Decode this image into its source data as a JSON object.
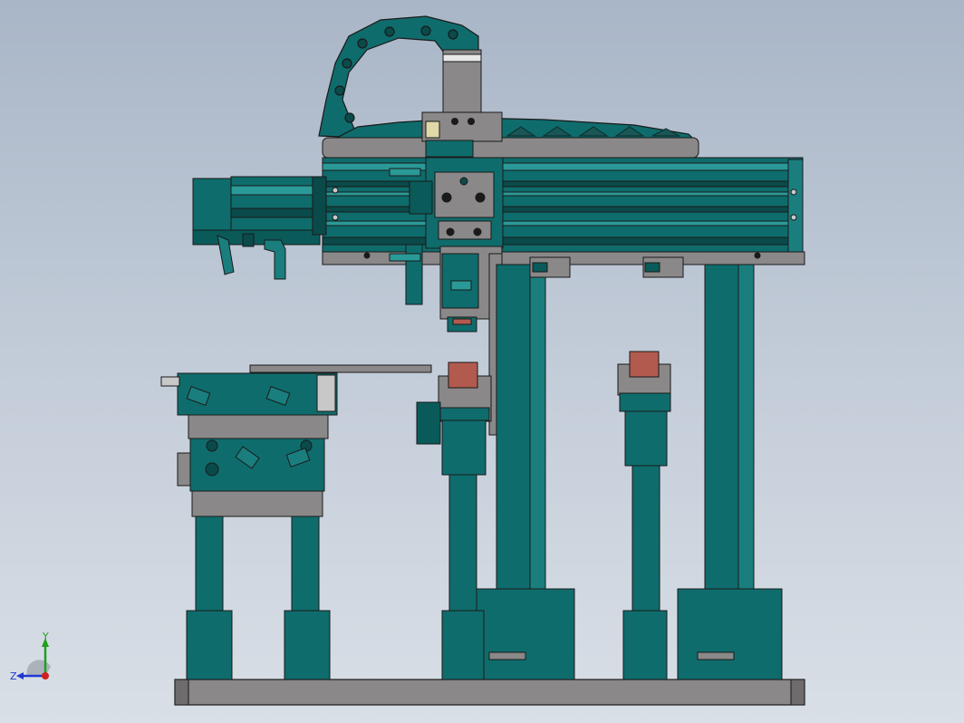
{
  "viewport": {
    "background_top": "#a9b6c7",
    "background_bottom": "#d9dfe6"
  },
  "palette": {
    "teal": "#0f6c6c",
    "teal_dark": "#0a4a4a",
    "teal_light": "#2a9a98",
    "steel": "#8a8888",
    "steel_dark": "#5e5c5c",
    "steel_light": "#b0aeae",
    "red_pad": "#b35a4e",
    "outline": "#1a1a1a"
  },
  "triad": {
    "x_label": "",
    "y_label": "Y",
    "z_label": "Z",
    "y_color": "#1fa01f",
    "z_color": "#1f3ad0",
    "origin_color": "#d01f1f"
  },
  "model": {
    "components": [
      "base-plate",
      "cable-drag-chain",
      "linear-actuator",
      "servo-motor",
      "vertical-slide",
      "support-columns",
      "feeder-table",
      "lift-cylinders"
    ]
  }
}
